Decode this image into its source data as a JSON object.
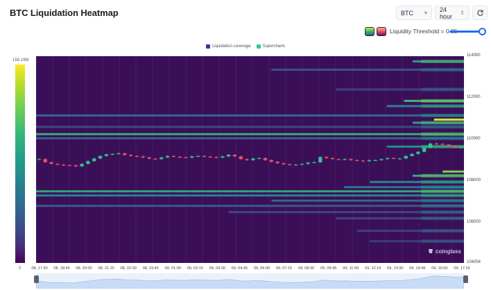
{
  "header": {
    "title": "BTC Liquidation Heatmap",
    "coin_select": "BTC",
    "range_select": "24 hour",
    "refresh_icon": "refresh-icon"
  },
  "controls": {
    "threshold_label": "Liquidity Threshold = 0.85",
    "threshold_value": 0.85,
    "theme_colors": [
      "#35b779",
      "#e5466c"
    ]
  },
  "legend": [
    {
      "label": "Liquidation Leverage",
      "color": "#5b2a86"
    },
    {
      "label": "Supercharts",
      "color": "#35c987"
    }
  ],
  "colorbar": {
    "max": "158.19M",
    "min": "0"
  },
  "watermark": "coinglass",
  "chart_data": {
    "type": "heatmap",
    "title": "BTC Liquidation Heatmap",
    "y_ticks": [
      "114000",
      "112000",
      "110000",
      "108000",
      "106000",
      "104054"
    ],
    "ylim": [
      104054,
      114000
    ],
    "x_ticks": [
      "08, 17:30",
      "08, 18:45",
      "08, 20:00",
      "08, 21:15",
      "08, 22:30",
      "08, 23:45",
      "09, 01:00",
      "09, 02:15",
      "09, 03:30",
      "09, 04:45",
      "09, 06:00",
      "09, 07:15",
      "09, 08:30",
      "09, 09:45",
      "09, 11:00",
      "09, 12:15",
      "09, 13:30",
      "09, 14:45",
      "09, 16:00",
      "09, 17:15"
    ],
    "colorscale": "viridis",
    "value_range": [
      0,
      158190000
    ],
    "liquidity_bands": [
      {
        "price": 113750,
        "start": 0.88,
        "intensity": 0.55
      },
      {
        "price": 113350,
        "start": 0.55,
        "intensity": 0.25
      },
      {
        "price": 112400,
        "start": 0.7,
        "intensity": 0.2
      },
      {
        "price": 111850,
        "start": 0.86,
        "intensity": 0.65
      },
      {
        "price": 111600,
        "start": 0.82,
        "intensity": 0.45
      },
      {
        "price": 111150,
        "start": 0.0,
        "intensity": 0.35
      },
      {
        "price": 110950,
        "start": 0.93,
        "intensity": 0.95
      },
      {
        "price": 110800,
        "start": 0.88,
        "intensity": 0.55
      },
      {
        "price": 110600,
        "start": 0.0,
        "intensity": 0.22
      },
      {
        "price": 110250,
        "start": 0.0,
        "intensity": 0.6
      },
      {
        "price": 110050,
        "start": 0.0,
        "intensity": 0.3
      },
      {
        "price": 109650,
        "start": 0.82,
        "intensity": 0.5
      },
      {
        "price": 108450,
        "start": 0.95,
        "intensity": 0.8
      },
      {
        "price": 108250,
        "start": 0.88,
        "intensity": 0.6
      },
      {
        "price": 107950,
        "start": 0.78,
        "intensity": 0.45
      },
      {
        "price": 107700,
        "start": 0.72,
        "intensity": 0.38
      },
      {
        "price": 107500,
        "start": 0.0,
        "intensity": 0.58
      },
      {
        "price": 107300,
        "start": 0.0,
        "intensity": 0.45
      },
      {
        "price": 107050,
        "start": 0.55,
        "intensity": 0.32
      },
      {
        "price": 106800,
        "start": 0.0,
        "intensity": 0.28
      },
      {
        "price": 106500,
        "start": 0.45,
        "intensity": 0.22
      },
      {
        "price": 106200,
        "start": 0.7,
        "intensity": 0.22
      },
      {
        "price": 105600,
        "start": 0.75,
        "intensity": 0.2
      },
      {
        "price": 105100,
        "start": 0.78,
        "intensity": 0.18
      }
    ],
    "price_series": [
      109050,
      108900,
      108820,
      108780,
      108760,
      108750,
      108700,
      108820,
      108950,
      109080,
      109200,
      109280,
      109300,
      109330,
      109250,
      109200,
      109180,
      109130,
      109070,
      109050,
      109130,
      109200,
      109160,
      109140,
      109120,
      109180,
      109200,
      109170,
      109150,
      109120,
      109180,
      109260,
      109180,
      109050,
      109000,
      109080,
      109100,
      109000,
      108920,
      108850,
      108800,
      108780,
      108780,
      108820,
      108880,
      108900,
      109150,
      109100,
      109050,
      109030,
      109050,
      109000,
      108980,
      108950,
      109000,
      109000,
      109050,
      109100,
      109080,
      109080,
      109200,
      109300,
      109400,
      109600,
      109800,
      109780,
      109750,
      109680,
      109600,
      109620
    ]
  }
}
